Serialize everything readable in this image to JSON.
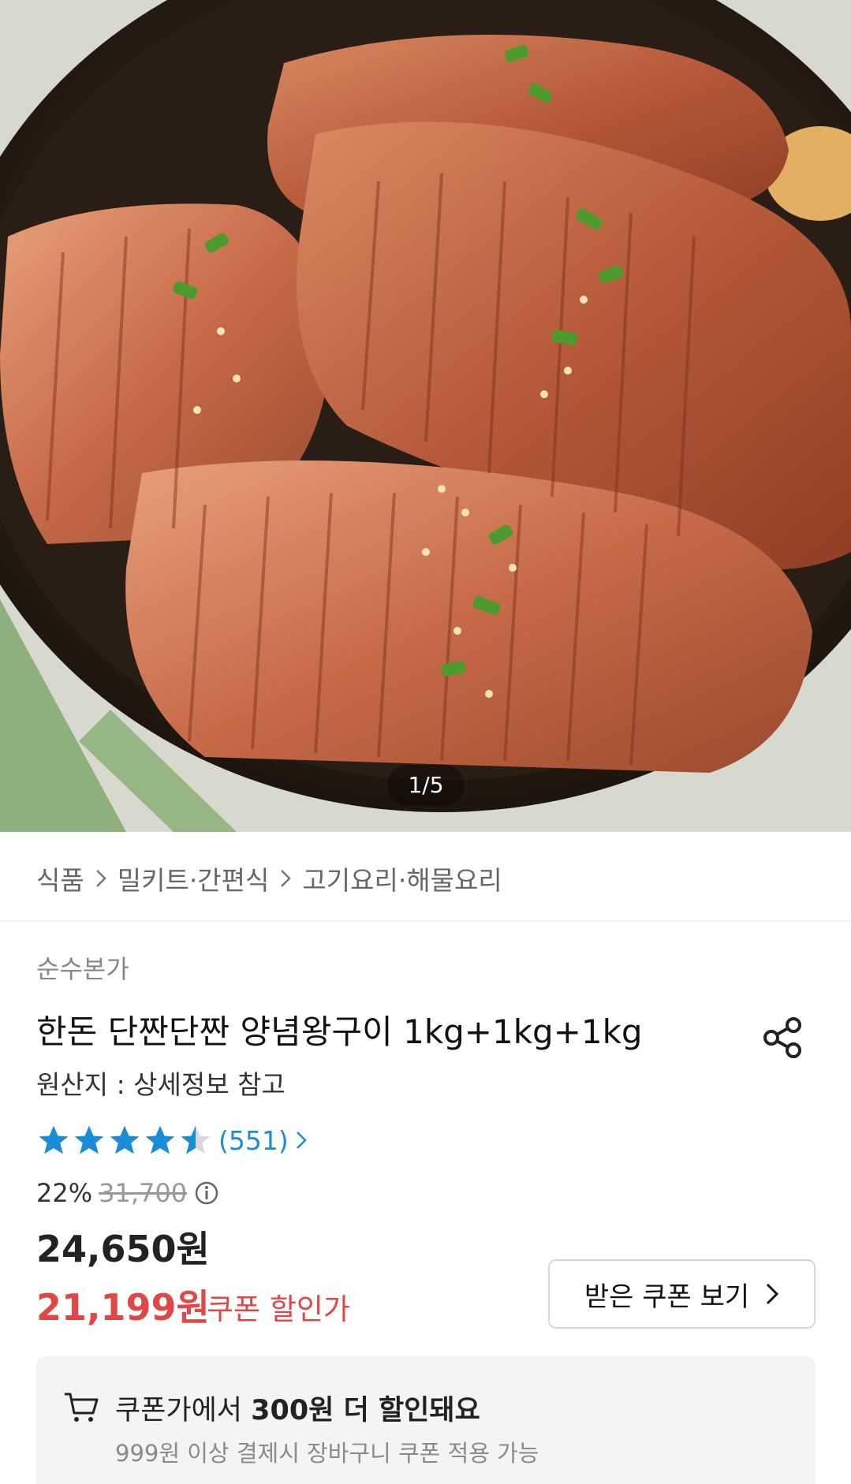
{
  "gallery": {
    "pager": "1/5",
    "image_alt": "양념왕구이"
  },
  "breadcrumb": [
    "식품",
    "밀키트·간편식",
    "고기요리·해물요리"
  ],
  "product": {
    "brand": "순수본가",
    "title": "한돈 단짠단짠 양념왕구이 1kg+1kg+1kg",
    "origin": "원산지 : 상세정보 참고"
  },
  "rating": {
    "stars": 4.5,
    "review_count": "(551)",
    "star_color": "#1a8cd8"
  },
  "price": {
    "discount_rate": "22%",
    "original_price": "31,700",
    "sale_price": "24,650원",
    "coupon_price": "21,199원",
    "coupon_label": "쿠폰 할인가",
    "coupon_color": "#e04848"
  },
  "coupon_button": {
    "label": "받은 쿠폰 보기"
  },
  "coupon_notice": {
    "prefix": "쿠폰가에서 ",
    "amount": "300원 더 할인돼요",
    "sub": "999원 이상 결제시 장바구니 쿠폰 적용 가능"
  },
  "icons": {
    "share": "share-icon",
    "breadcrumb_separator": "chevron-right-icon",
    "info": "info-icon",
    "cart": "cart-icon"
  }
}
